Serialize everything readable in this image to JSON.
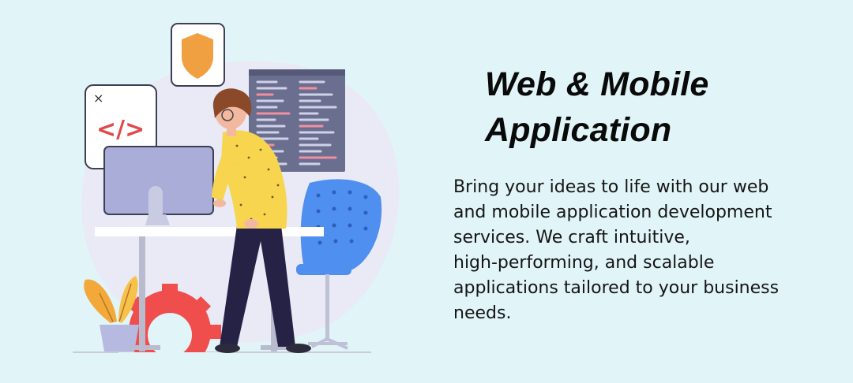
{
  "hero": {
    "title_lines": [
      "Web & Mobile",
      "Application"
    ],
    "description_lines": [
      "Bring your ideas to life with our web",
      "and mobile application development",
      "services. We craft intuitive,",
      "high-performing, and scalable",
      "applications tailored to your business",
      "needs."
    ],
    "code_card_symbol": "</>",
    "code_card_close": "×"
  },
  "colors": {
    "background": "#e1f5f8",
    "blob": "#e9eaf6",
    "shield": "#f0a040",
    "code": "#e04a4a",
    "monitor": "#a9add8",
    "shirt": "#f7d54e",
    "pants": "#262246",
    "chair": "#4f8fef",
    "gear": "#f04d4d",
    "leaf": "#f2a93a"
  },
  "icons": [
    "shield-icon",
    "code-icon",
    "close-icon",
    "gear-icon"
  ]
}
